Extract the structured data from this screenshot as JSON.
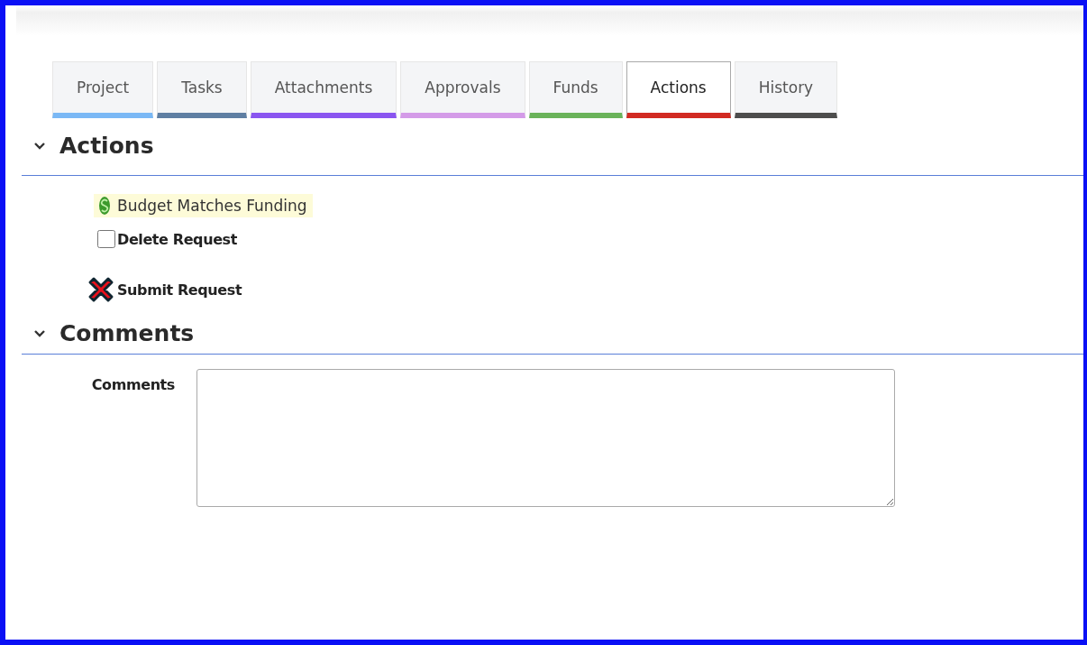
{
  "tabs": [
    {
      "label": "Project",
      "selected": false,
      "color": "#7ab8f5"
    },
    {
      "label": "Tasks",
      "selected": false,
      "color": "#5f7fa3"
    },
    {
      "label": "Attachments",
      "selected": false,
      "color": "#8a55f0"
    },
    {
      "label": "Approvals",
      "selected": false,
      "color": "#d49be8"
    },
    {
      "label": "Funds",
      "selected": false,
      "color": "#6ab35a"
    },
    {
      "label": "Actions",
      "selected": true,
      "color": "#d22a22"
    },
    {
      "label": "History",
      "selected": false,
      "color": "#4d4d4d"
    }
  ],
  "actions_section": {
    "title": "Actions",
    "expanded": true,
    "items": [
      {
        "kind": "status",
        "label": "Budget Matches Funding"
      },
      {
        "kind": "checkbox",
        "label": "Delete Request",
        "checked": false
      },
      {
        "kind": "blocked",
        "label": "Submit Request"
      }
    ]
  },
  "comments_section": {
    "title": "Comments",
    "expanded": true,
    "field_label": "Comments"
  }
}
